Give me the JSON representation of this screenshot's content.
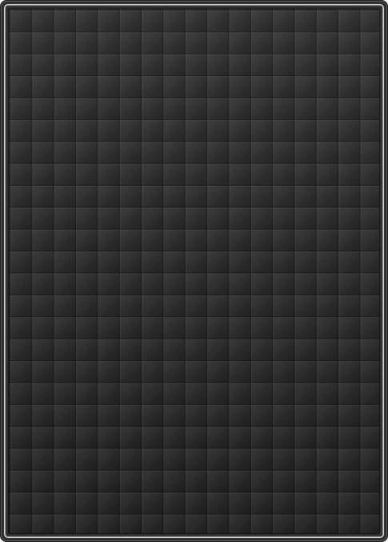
{
  "window": {
    "background_color": "#2f2f2f",
    "frame_color": "#d6d6d6",
    "tile_color": "#2e2e2e",
    "tile_grid": {
      "columns": 17,
      "rows": 24
    }
  }
}
